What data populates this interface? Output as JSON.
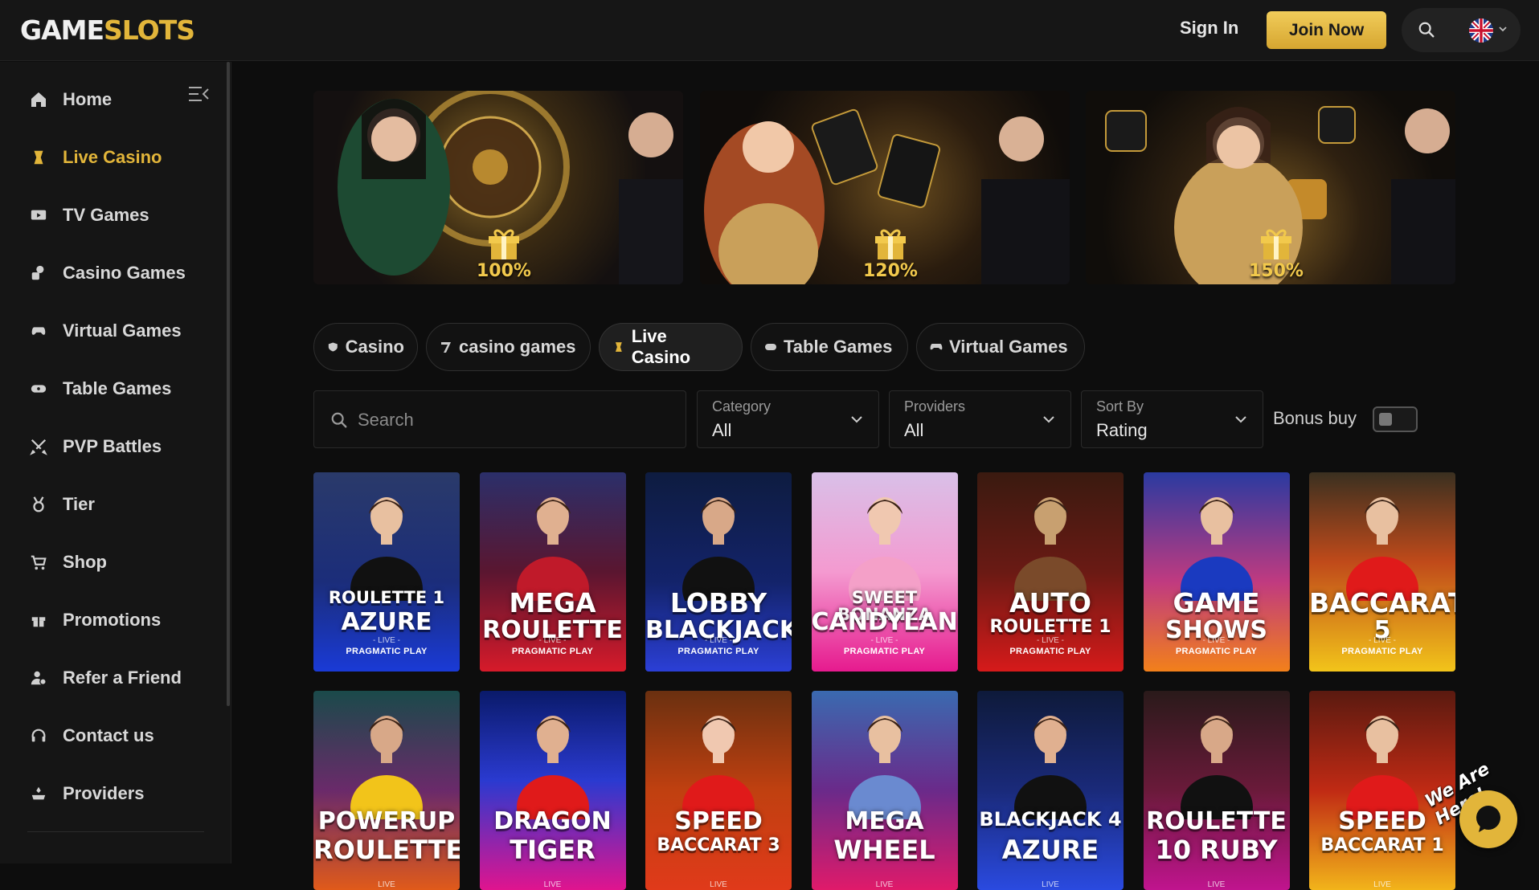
{
  "brand": {
    "logo_left": "GAME",
    "logo_right": "SLOTS",
    "accent": "#e2b53a"
  },
  "header": {
    "sign_in": "Sign In",
    "join_now": "Join Now",
    "language": "English (UK)"
  },
  "sidebar": {
    "items": [
      {
        "label": "Home",
        "icon": "home-icon"
      },
      {
        "label": "Live Casino",
        "icon": "live-casino-icon",
        "active": true
      },
      {
        "label": "TV Games",
        "icon": "tv-icon"
      },
      {
        "label": "Casino Games",
        "icon": "casino-icon"
      },
      {
        "label": "Virtual Games",
        "icon": "virtual-icon"
      },
      {
        "label": "Table Games",
        "icon": "table-icon"
      },
      {
        "label": "PVP Battles",
        "icon": "swords-icon"
      },
      {
        "label": "Tier",
        "icon": "medal-icon"
      },
      {
        "label": "Shop",
        "icon": "cart-icon"
      },
      {
        "label": "Promotions",
        "icon": "gift-icon"
      },
      {
        "label": "Refer a Friend",
        "icon": "refer-icon"
      },
      {
        "label": "Contact us",
        "icon": "headset-icon"
      },
      {
        "label": "Providers",
        "icon": "providers-icon"
      }
    ]
  },
  "banners": [
    {
      "percent": "100%"
    },
    {
      "percent": "120%"
    },
    {
      "percent": "150%"
    }
  ],
  "categories": [
    {
      "label": "Casino"
    },
    {
      "label": "casino games"
    },
    {
      "label": "Live Casino",
      "active": true
    },
    {
      "label": "Table Games"
    },
    {
      "label": "Virtual Games"
    }
  ],
  "filters": {
    "search_placeholder": "Search",
    "category": {
      "label": "Category",
      "value": "All"
    },
    "providers": {
      "label": "Providers",
      "value": "All"
    },
    "sort": {
      "label": "Sort By",
      "value": "Rating"
    },
    "bonus_buy": {
      "label": "Bonus buy",
      "enabled": false
    }
  },
  "games": [
    {
      "line1": "ROULETTE 1",
      "line2": "AZURE",
      "live": "- LIVE -",
      "provider": "PRAGMATIC PLAY"
    },
    {
      "line1": "MEGA",
      "line2": "ROULETTE",
      "live": "- LIVE -",
      "provider": "PRAGMATIC PLAY"
    },
    {
      "line1": "LOBBY",
      "line2": "BLACKJACK",
      "live": "- LIVE -",
      "provider": "PRAGMATIC PLAY"
    },
    {
      "line1": "SWEET BONANZA",
      "line2": "CANDYLAND",
      "live": "- LIVE -",
      "provider": "PRAGMATIC PLAY"
    },
    {
      "line1": "AUTO",
      "line2": "ROULETTE 1",
      "live": "- LIVE -",
      "provider": "PRAGMATIC PLAY"
    },
    {
      "line1": "GAME",
      "line2": "SHOWS",
      "live": "- LIVE -",
      "provider": "PRAGMATIC PLAY"
    },
    {
      "line1": "BACCARAT",
      "line2": "5",
      "live": "- LIVE -",
      "provider": "PRAGMATIC PLAY"
    },
    {
      "line1": "POWERUP",
      "line2": "ROULETTE",
      "live": "LIVE"
    },
    {
      "line1": "DRAGON",
      "line2": "TIGER",
      "live": "LIVE"
    },
    {
      "line1": "SPEED",
      "line2": "BACCARAT 3",
      "live": "LIVE"
    },
    {
      "line1": "MEGA",
      "line2": "WHEEL",
      "live": "LIVE"
    },
    {
      "line1": "BLACKJACK 4",
      "line2": "AZURE",
      "live": "LIVE"
    },
    {
      "line1": "ROULETTE",
      "line2": "10 RUBY",
      "live": "LIVE"
    },
    {
      "line1": "SPEED",
      "line2": "BACCARAT 1",
      "live": "LIVE"
    }
  ],
  "chat": {
    "label": "We Are Here!"
  }
}
